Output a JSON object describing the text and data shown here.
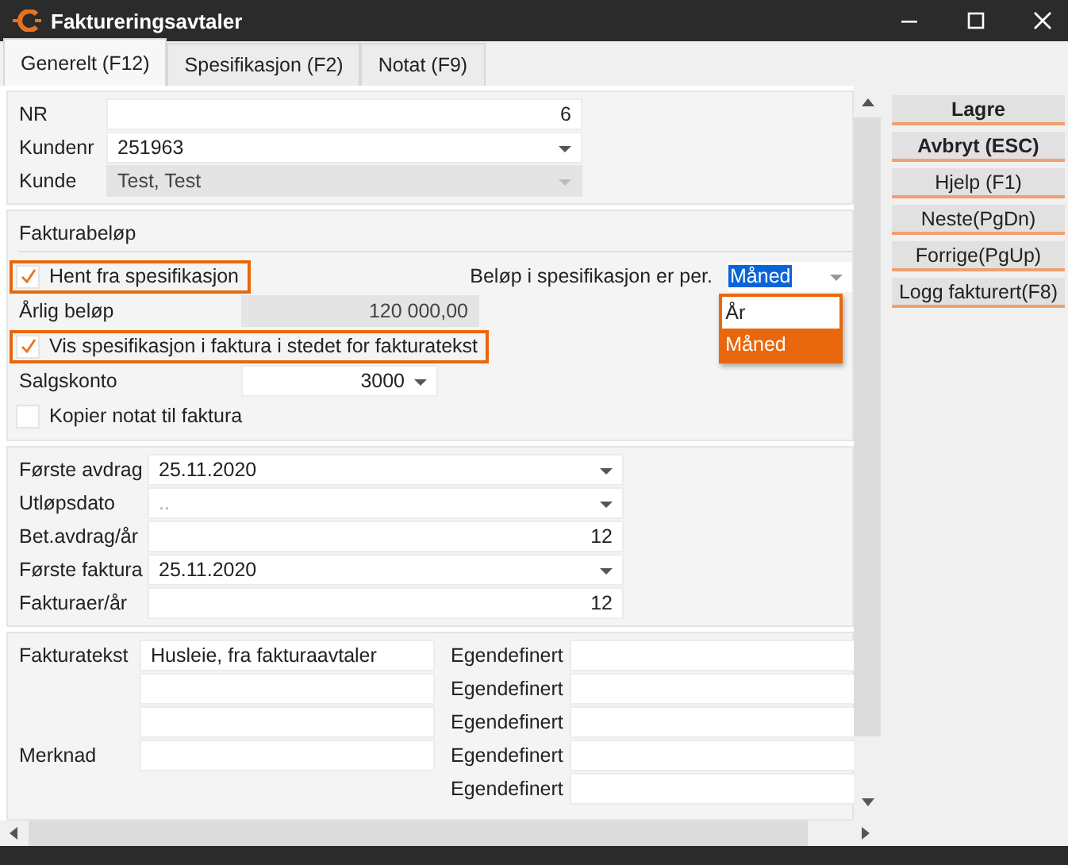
{
  "window": {
    "title": "Faktureringsavtaler"
  },
  "tabs": [
    {
      "label": "Generelt (F12)",
      "selected": true
    },
    {
      "label": "Spesifikasjon (F2)",
      "selected": false
    },
    {
      "label": "Notat (F9)",
      "selected": false
    }
  ],
  "customer": {
    "fields": [
      {
        "label": "NR",
        "value": "6",
        "kind": "number",
        "disabled": false
      },
      {
        "label": "Kundenr",
        "value": "251963",
        "kind": "dropdown",
        "disabled": false
      },
      {
        "label": "Kunde",
        "value": "Test, Test",
        "kind": "dropdown",
        "disabled": true
      }
    ]
  },
  "amount": {
    "title": "Fakturabeløp",
    "fetch_from_spec": {
      "label": "Hent fra spesifikasjon",
      "checked": true,
      "highlighted": true
    },
    "period": {
      "label": "Beløp i spesifikasjon er per.",
      "value": "Måned",
      "highlighted": true,
      "options": [
        {
          "label": "År",
          "selected": false
        },
        {
          "label": "Måned",
          "selected": true
        }
      ]
    },
    "annual": {
      "label": "Årlig beløp",
      "value": "120 000,00"
    },
    "show_spec": {
      "label": "Vis spesifikasjon i faktura i stedet for fakturatekst",
      "checked": true,
      "highlighted": true
    },
    "sales_account": {
      "label": "Salgskonto",
      "value": "3000"
    },
    "copy_note": {
      "label": "Kopier notat til faktura",
      "checked": false,
      "highlighted": false
    }
  },
  "schedule": {
    "fields": [
      {
        "label": "Første avdrag",
        "value": "25.11.2020",
        "kind": "dropdown"
      },
      {
        "label": "Utløpsdato",
        "placeholder": "..",
        "kind": "dropdown"
      },
      {
        "label": "Bet.avdrag/år",
        "value": "12",
        "kind": "number"
      },
      {
        "label": "Første faktura",
        "value": "25.11.2020",
        "kind": "dropdown"
      },
      {
        "label": "Fakturaer/år",
        "value": "12",
        "kind": "number"
      }
    ]
  },
  "texts": {
    "left": [
      {
        "kind": "labeled",
        "label": "Fakturatekst",
        "value": "Husleie, fra fakturaavtaler"
      },
      {
        "kind": "unlabeled"
      },
      {
        "kind": "unlabeled"
      },
      {
        "kind": "labeled",
        "label": "Merknad"
      }
    ],
    "custom": [
      {
        "label": "Egendefinert"
      },
      {
        "label": "Egendefinert"
      },
      {
        "label": "Egendefinert"
      },
      {
        "label": "Egendefinert"
      },
      {
        "label": "Egendefinert"
      }
    ]
  },
  "buttons": [
    {
      "label": "Lagre",
      "bold": true
    },
    {
      "label": "Avbryt (ESC)",
      "bold": true
    },
    {
      "label": "Hjelp (F1)",
      "bold": false
    },
    {
      "label": "Neste(PgDn)",
      "bold": false
    },
    {
      "label": "Forrige(PgUp)",
      "bold": false
    },
    {
      "label": "Logg fakturert(F8)",
      "bold": false
    }
  ]
}
